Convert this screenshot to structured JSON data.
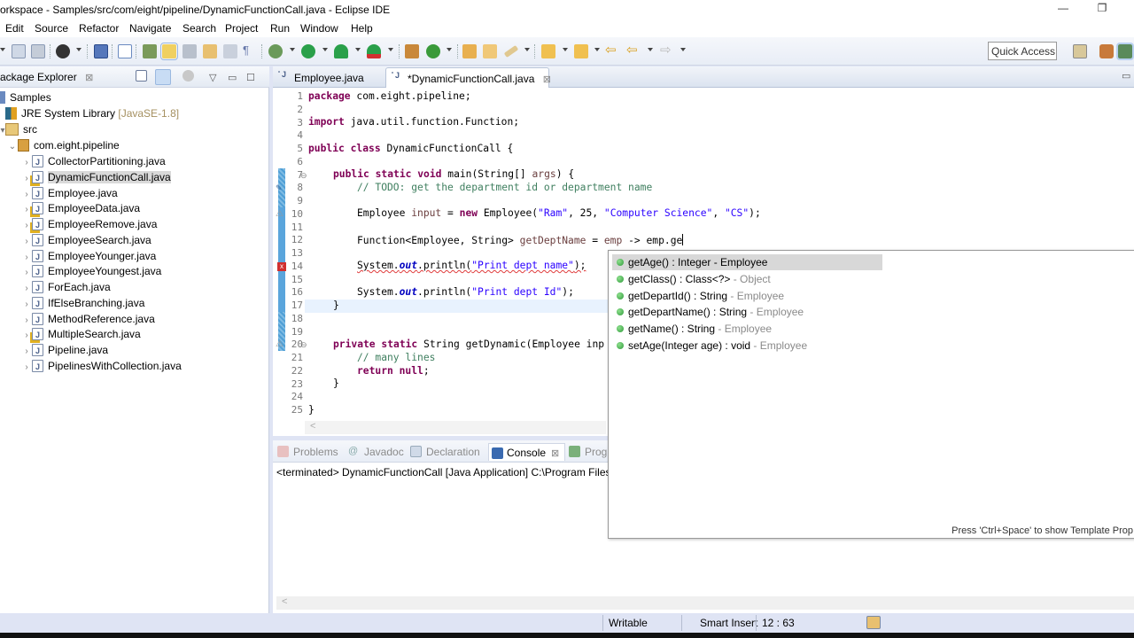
{
  "window": {
    "title": "orkspace - Samples/src/com/eight/pipeline/DynamicFunctionCall.java - Eclipse IDE",
    "minimize_glyph": "—",
    "restore_glyph": "❐"
  },
  "menubar": {
    "items": [
      "Edit",
      "Source",
      "Refactor",
      "Navigate",
      "Search",
      "Project",
      "Run",
      "Window",
      "Help"
    ]
  },
  "toolbar": {
    "quick_access_label": "Quick Access",
    "icons": [
      "save-icon",
      "save-all-icon",
      "profile-icon",
      "terminal-icon",
      "skip-breakpoints-icon",
      "pin-icon",
      "highlight-icon",
      "occurrences-icon",
      "block-selection-icon",
      "show-whitespace-icon",
      "debug-icon",
      "run-icon",
      "run-coverage-icon",
      "run-external-tool-icon",
      "new-package-icon",
      "new-class-icon",
      "open-type-icon",
      "open-task-icon",
      "pen-icon",
      "next-annotation-icon",
      "prev-annotation-icon",
      "last-edit-icon",
      "back-icon",
      "forward-icon"
    ],
    "perspective_icons": [
      "open-perspective-icon",
      "java-ee-perspective-icon",
      "java-perspective-icon"
    ]
  },
  "package_explorer": {
    "title": "ackage Explorer",
    "close_glyph": "⊠",
    "tree": [
      {
        "label": "Samples",
        "type": "project"
      },
      {
        "label": "JRE System Library",
        "decoration": "[JavaSE-1.8]",
        "type": "library"
      },
      {
        "label": "src",
        "type": "source-folder"
      },
      {
        "label": "com.eight.pipeline",
        "type": "package"
      },
      {
        "label": "CollectorPartitioning.java",
        "type": "java"
      },
      {
        "label": "DynamicFunctionCall.java",
        "type": "java",
        "selected": true,
        "warning": true
      },
      {
        "label": "Employee.java",
        "type": "java"
      },
      {
        "label": "EmployeeData.java",
        "type": "java",
        "warning": true
      },
      {
        "label": "EmployeeRemove.java",
        "type": "java",
        "warning": true
      },
      {
        "label": "EmployeeSearch.java",
        "type": "java"
      },
      {
        "label": "EmployeeYounger.java",
        "type": "java"
      },
      {
        "label": "EmployeeYoungest.java",
        "type": "java"
      },
      {
        "label": "ForEach.java",
        "type": "java"
      },
      {
        "label": "IfElseBranching.java",
        "type": "java"
      },
      {
        "label": "MethodReference.java",
        "type": "java"
      },
      {
        "label": "MultipleSearch.java",
        "type": "java",
        "warning": true
      },
      {
        "label": "Pipeline.java",
        "type": "java"
      },
      {
        "label": "PipelinesWithCollection.java",
        "type": "java"
      }
    ]
  },
  "editor": {
    "tabs": [
      {
        "label": "Employee.java",
        "active": false
      },
      {
        "label": "*DynamicFunctionCall.java",
        "active": true
      }
    ],
    "tab_close_glyph": "⊠",
    "line_numbers": [
      "1",
      "2",
      "3",
      "4",
      "5",
      "6",
      "7",
      "8",
      "9",
      "10",
      "11",
      "12",
      "13",
      "14",
      "15",
      "16",
      "17",
      "18",
      "19",
      "20",
      "21",
      "22",
      "23",
      "24",
      "25"
    ],
    "lines": {
      "l1": {
        "kw": "package",
        "rest": " com.eight.pipeline;"
      },
      "l3": {
        "kw": "import",
        "rest": " java.util.function.Function;"
      },
      "l5": {
        "kw1": "public",
        "kw2": "class",
        "rest": " DynamicFunctionCall {"
      },
      "l7": {
        "kw1": "public",
        "kw2": "static",
        "kw3": "void",
        "rest": " main(String[] ",
        "param": "args",
        "tail": ") {"
      },
      "l8": {
        "comment": "// TODO: get the department id or department name"
      },
      "l10": {
        "a": "Employee ",
        "var": "input",
        "b": " = ",
        "kw": "new",
        "c": " Employee(",
        "s1": "\"Ram\"",
        "d": ", 25, ",
        "s2": "\"Computer Science\"",
        "e": ", ",
        "s3": "\"CS\"",
        "f": ");"
      },
      "l12": {
        "a": "Function<Employee, String> ",
        "var": "getDeptName",
        "b": " = ",
        "param": "emp",
        "c": " -> emp.ge"
      },
      "l14": {
        "a": "System.",
        "field": "out",
        "b": ".println(",
        "s": "\"Print dept name\"",
        "c": ");"
      },
      "l16": {
        "a": "System.",
        "field": "out",
        "b": ".println(",
        "s": "\"Print dept Id\"",
        "c": ");"
      },
      "l17": {
        "text": "}"
      },
      "l20": {
        "kw1": "private",
        "kw2": "static",
        "rest": " String getDynamic(Employee inp"
      },
      "l21": {
        "comment": "// many lines"
      },
      "l22": {
        "kw1": "return",
        "kw2": "null",
        "rest": ";"
      },
      "l23": {
        "text": "}"
      },
      "l25": {
        "text": "}"
      }
    },
    "scroll_glyph": "<"
  },
  "content_assist": {
    "items": [
      {
        "sig": "getAge() : Integer - Employee",
        "owner": "",
        "selected": true
      },
      {
        "sig": "getClass() : Class<?>",
        "owner": " - Object"
      },
      {
        "sig": "getDepartId() : String",
        "owner": " - Employee"
      },
      {
        "sig": "getDepartName() : String",
        "owner": " - Employee"
      },
      {
        "sig": "getName() : String",
        "owner": " - Employee"
      },
      {
        "sig": "setAge(Integer age) : void",
        "owner": " - Employee"
      }
    ],
    "hint": "Press 'Ctrl+Space' to show Template Prop"
  },
  "bottom_panel": {
    "tabs": [
      {
        "label": "Problems",
        "active": false
      },
      {
        "label": "Javadoc",
        "active": false
      },
      {
        "label": "Declaration",
        "active": false
      },
      {
        "label": "Console",
        "active": true
      },
      {
        "label": "Prog",
        "active": false
      }
    ],
    "console_description": "<terminated> DynamicFunctionCall [Java Application] C:\\Program Files\\",
    "scroll_glyph": "<"
  },
  "statusbar": {
    "writable": "Writable",
    "insert_mode": "Smart Insert",
    "cursor_position": "12 : 63"
  },
  "colors": {
    "keyword": "#7f0055",
    "string": "#2a00ff",
    "comment": "#3f7f5f",
    "static_field": "#0000c0",
    "statusbar_bg": "#dfe4f4"
  }
}
